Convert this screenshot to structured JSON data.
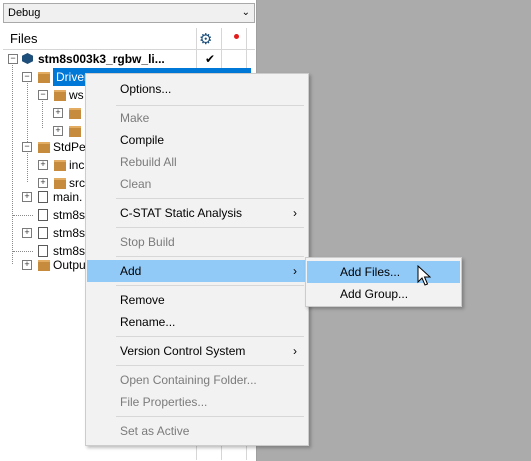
{
  "config": {
    "selected": "Debug"
  },
  "files_panel": {
    "title": "Files",
    "tree": [
      {
        "label": "stm8s003k3_rgbw_li...",
        "type": "project",
        "check": "✔"
      },
      {
        "label": "Drivers",
        "type": "folder",
        "selected": true
      },
      {
        "label": "ws",
        "type": "folder"
      },
      {
        "label": "",
        "type": "folder"
      },
      {
        "label": "",
        "type": "folder"
      },
      {
        "label": "StdPe",
        "type": "folder"
      },
      {
        "label": "inc",
        "type": "folder"
      },
      {
        "label": "src",
        "type": "folder"
      },
      {
        "label": "main.",
        "type": "file"
      },
      {
        "label": "stm8s",
        "type": "file"
      },
      {
        "label": "stm8s",
        "type": "file"
      },
      {
        "label": "stm8s",
        "type": "file"
      },
      {
        "label": "Outpu",
        "type": "folder"
      }
    ]
  },
  "context_menu": {
    "items": [
      {
        "label": "Options...",
        "enabled": true
      },
      {
        "label": "Make",
        "enabled": false
      },
      {
        "label": "Compile",
        "enabled": true
      },
      {
        "label": "Rebuild All",
        "enabled": false
      },
      {
        "label": "Clean",
        "enabled": false
      },
      {
        "label": "C-STAT Static Analysis",
        "enabled": true,
        "submenu": true
      },
      {
        "label": "Stop Build",
        "enabled": false
      },
      {
        "label": "Add",
        "enabled": true,
        "submenu": true,
        "highlighted": true
      },
      {
        "label": "Remove",
        "enabled": true
      },
      {
        "label": "Rename...",
        "enabled": true
      },
      {
        "label": "Version Control System",
        "enabled": true,
        "submenu": true
      },
      {
        "label": "Open Containing Folder...",
        "enabled": false
      },
      {
        "label": "File Properties...",
        "enabled": false
      },
      {
        "label": "Set as Active",
        "enabled": false
      }
    ],
    "submenu_arrow": "›"
  },
  "add_submenu": {
    "items": [
      {
        "label": "Add Files...",
        "highlighted": true
      },
      {
        "label": "Add Group..."
      }
    ]
  },
  "icons": {
    "gear": "gear-icon",
    "breakpoint": "red-dot-icon",
    "cursor": "mouse-pointer-icon"
  },
  "colors": {
    "selection": "#0078d7",
    "menu_highlight": "#91c9f7",
    "background": "#ababab"
  }
}
